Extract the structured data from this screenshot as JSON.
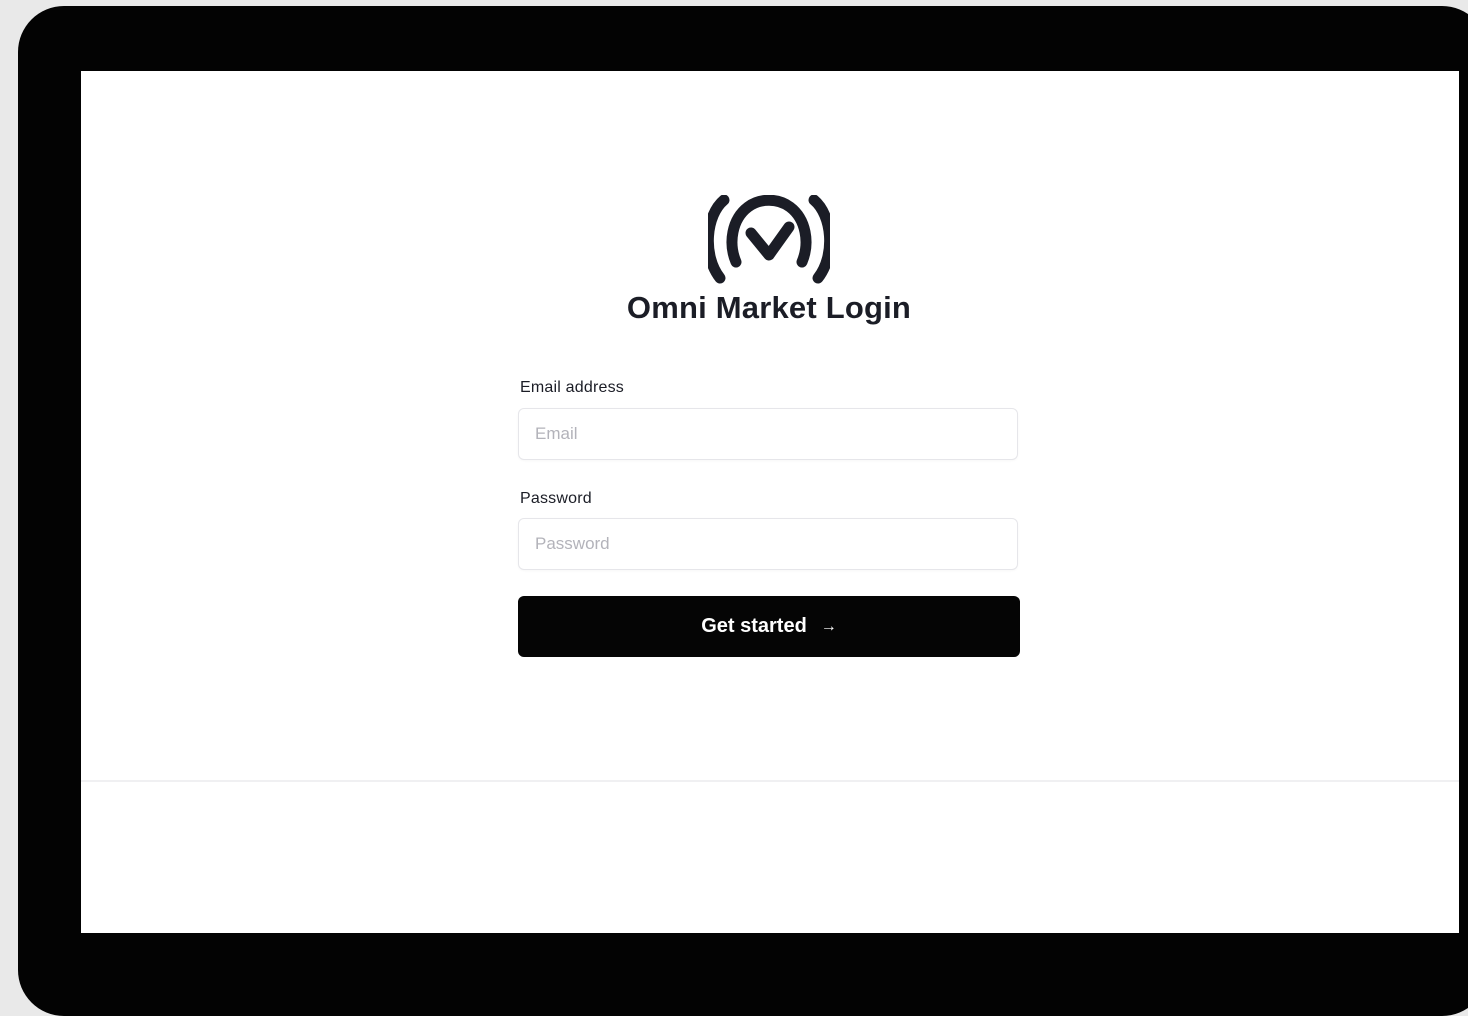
{
  "brand": {
    "logo_icon": "omni-market-logo",
    "title": "Omni Market Login"
  },
  "form": {
    "email": {
      "label": "Email address",
      "placeholder": "Email",
      "value": ""
    },
    "password": {
      "label": "Password",
      "placeholder": "Password",
      "value": ""
    },
    "submit": {
      "label": "Get started",
      "icon": "arrow-right-icon",
      "glyph": "→"
    }
  },
  "colors": {
    "primary": "#050505",
    "text": "#1b1d26",
    "placeholder": "#b3b3ba",
    "border": "#e6e6ea",
    "bezel": "#030303",
    "backdrop": "#e9e9e9"
  }
}
